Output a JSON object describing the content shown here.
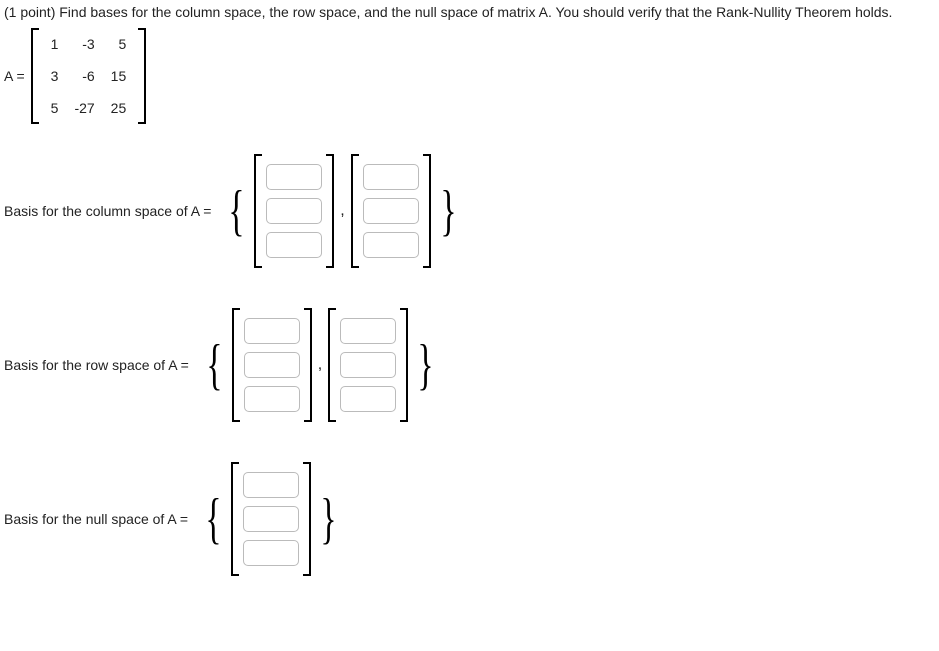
{
  "question": "(1 point) Find bases for the column space, the row space, and the null space of matrix A. You should verify that the Rank-Nullity Theorem holds.",
  "matrix_label": "A =",
  "matrix_A": [
    [
      "1",
      "-3",
      "5"
    ],
    [
      "3",
      "-6",
      "15"
    ],
    [
      "5",
      "-27",
      "25"
    ]
  ],
  "col_label": "Basis for the column space of A =",
  "row_label": "Basis for the row space of A =",
  "null_label": "Basis for the null space of A =",
  "brace_open": "{",
  "brace_close": "}",
  "comma": ",",
  "col_basis": {
    "v1": [
      "",
      "",
      ""
    ],
    "v2": [
      "",
      "",
      ""
    ]
  },
  "row_basis": {
    "v1": [
      "",
      "",
      ""
    ],
    "v2": [
      "",
      "",
      ""
    ]
  },
  "null_basis": {
    "v1": [
      "",
      "",
      ""
    ]
  }
}
